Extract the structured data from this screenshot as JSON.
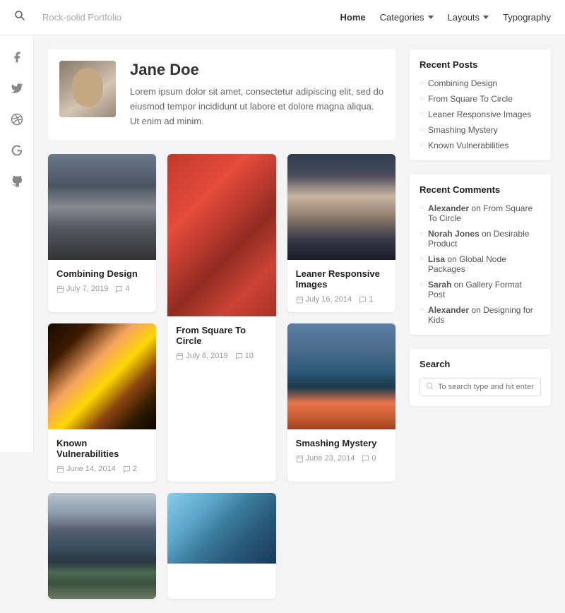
{
  "nav": {
    "site_title": "Rock-solid Portfolio",
    "links": [
      {
        "label": "Home",
        "active": true,
        "has_dropdown": false
      },
      {
        "label": "Categories",
        "active": false,
        "has_dropdown": true
      },
      {
        "label": "Layouts",
        "active": false,
        "has_dropdown": true
      },
      {
        "label": "Typography",
        "active": false,
        "has_dropdown": false
      }
    ]
  },
  "social_icons": [
    {
      "name": "facebook",
      "symbol": "f"
    },
    {
      "name": "twitter",
      "symbol": "t"
    },
    {
      "name": "dribbble",
      "symbol": "d"
    },
    {
      "name": "google",
      "symbol": "G"
    },
    {
      "name": "github",
      "symbol": "g"
    }
  ],
  "author": {
    "name": "Jane Doe",
    "bio": "Lorem ipsum dolor sit amet, consectetur adipiscing elit, sed do eiusmod tempor incididunt ut labore et dolore magna aliqua. Ut enim ad minim."
  },
  "posts": [
    {
      "id": 1,
      "title": "Combining Design",
      "date": "July 7, 2019",
      "comments": "4",
      "image_type": "railway",
      "col": 1,
      "row": 1
    },
    {
      "id": 2,
      "title": "From Square To Circle",
      "date": "July 6, 2019",
      "comments": "10",
      "image_type": "strawberry",
      "col": 2,
      "row": 1
    },
    {
      "id": 3,
      "title": "Leaner Responsive Images",
      "date": "July 16, 2014",
      "comments": "1",
      "image_type": "eyes",
      "col": 3,
      "row": 1
    },
    {
      "id": 4,
      "title": "Known Vulnerabilities",
      "date": "June 14, 2014",
      "comments": "2",
      "image_type": "concert",
      "col": 1,
      "row": 2
    },
    {
      "id": 5,
      "title": "Smashing Mystery",
      "date": "June 23, 2014",
      "comments": "0",
      "image_type": "canoe",
      "col": 3,
      "row": 2
    },
    {
      "id": 6,
      "title": "",
      "date": "",
      "comments": "",
      "image_type": "mountain",
      "col": 2,
      "row": 2
    },
    {
      "id": 7,
      "title": "",
      "date": "",
      "comments": "",
      "image_type": "wind",
      "col": 3,
      "row": 3
    }
  ],
  "sidebar": {
    "recent_posts": {
      "title": "Recent Posts",
      "items": [
        "Combining Design",
        "From Square To Circle",
        "Leaner Responsive Images",
        "Smashing Mystery",
        "Known Vulnerabilities"
      ]
    },
    "recent_comments": {
      "title": "Recent Comments",
      "items": [
        {
          "author": "Alexander",
          "text": "on From Square To Circle"
        },
        {
          "author": "Norah Jones",
          "text": "on Desirable Product"
        },
        {
          "author": "Lisa",
          "text": "on Global Node Packages"
        },
        {
          "author": "Sarah",
          "text": "on Gallery Format Post"
        },
        {
          "author": "Alexander",
          "text": "on Designing for Kids"
        }
      ]
    },
    "search": {
      "title": "Search",
      "placeholder": "To search type and hit enter"
    }
  }
}
